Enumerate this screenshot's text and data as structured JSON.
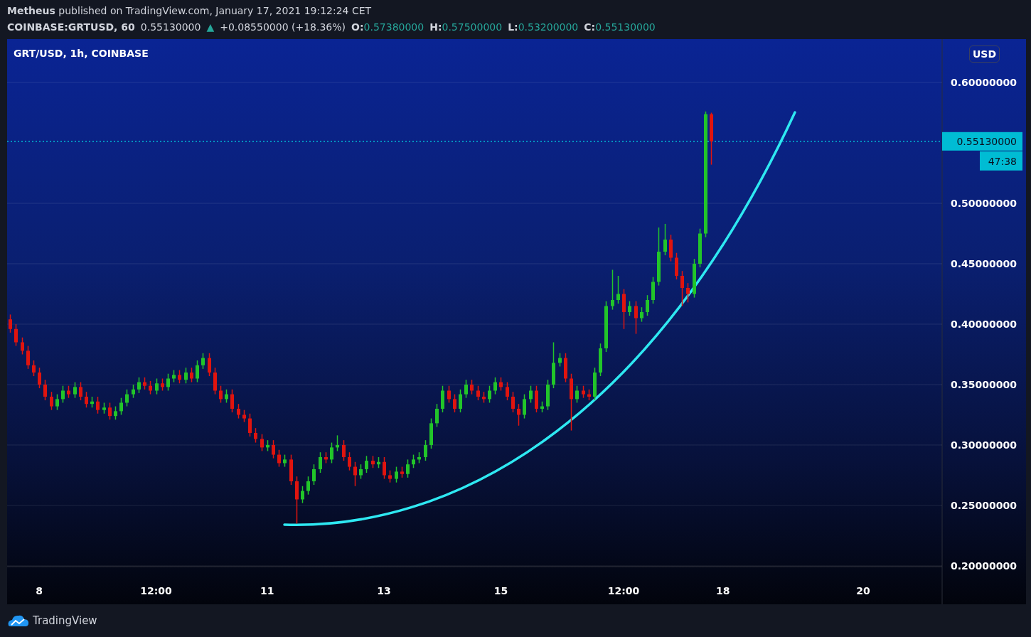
{
  "header": {
    "byline": "**Metheus** published on TradingView.com, January 17, 2021 19:12:24 CET",
    "symbol": "COINBASE:GRTUSD, 60",
    "last": "0.55130000",
    "direction_icon": "▲",
    "change": "+0.08550000 (+18.36%)",
    "ohlc": [
      {
        "label": "O:",
        "value": "0.57380000"
      },
      {
        "label": "H:",
        "value": "0.57500000"
      },
      {
        "label": "L:",
        "value": "0.53200000"
      },
      {
        "label": "C:",
        "value": "0.55130000"
      }
    ]
  },
  "chart_pane": {
    "legend": "GRT/USD, 1h, COINBASE",
    "currency_button": "USD",
    "last_price_label": "0.55130000",
    "countdown": "47:38",
    "chart_data": {
      "type": "candlestick",
      "grid": true,
      "ylim": [
        0.1682,
        0.6359
      ],
      "yticks": [
        {
          "value": 0.2,
          "label": "0.20000000"
        },
        {
          "value": 0.25,
          "label": "0.25000000"
        },
        {
          "value": 0.3,
          "label": "0.30000000"
        },
        {
          "value": 0.35,
          "label": "0.35000000"
        },
        {
          "value": 0.4,
          "label": "0.40000000"
        },
        {
          "value": 0.45,
          "label": "0.45000000"
        },
        {
          "value": 0.5,
          "label": "0.50000000"
        },
        {
          "value": 0.6,
          "label": "0.60000000"
        }
      ],
      "ref_lines": [
        {
          "axis": "y",
          "value": 0.5513,
          "color": "#00bcd4"
        }
      ],
      "categories": [
        null,
        null,
        null,
        null,
        null,
        "8",
        null,
        null,
        null,
        null,
        null,
        null,
        null,
        null,
        null,
        null,
        null,
        null,
        null,
        null,
        null,
        null,
        null,
        null,
        null,
        "12:00",
        null,
        null,
        null,
        null,
        null,
        null,
        null,
        null,
        null,
        null,
        null,
        null,
        null,
        null,
        null,
        null,
        null,
        null,
        "11",
        null,
        null,
        null,
        null,
        null,
        null,
        null,
        null,
        null,
        null,
        null,
        null,
        null,
        null,
        null,
        null,
        null,
        null,
        null,
        "13",
        null,
        null,
        null,
        null,
        null,
        null,
        null,
        null,
        null,
        null,
        null,
        null,
        null,
        null,
        null,
        null,
        null,
        null,
        null,
        "15",
        null,
        null,
        null,
        null,
        null,
        null,
        null,
        null,
        null,
        null,
        null,
        null,
        null,
        null,
        null,
        null,
        null,
        null,
        null,
        null,
        "12:00",
        null,
        null,
        null,
        null,
        null,
        null,
        null,
        null,
        null,
        null,
        null,
        null,
        null,
        null,
        null,
        null,
        "18",
        null,
        null,
        null,
        null,
        null,
        null,
        null,
        null,
        null,
        null,
        null,
        null,
        null,
        null,
        null,
        null,
        null,
        null,
        null,
        null,
        null,
        null,
        null,
        "20",
        null,
        null,
        null,
        null,
        null,
        null,
        null,
        null,
        null,
        null,
        null,
        null,
        null
      ],
      "ohlc": [
        [
          0.404,
          0.408,
          0.393,
          0.396
        ],
        [
          0.396,
          0.4,
          0.382,
          0.385
        ],
        [
          0.385,
          0.389,
          0.375,
          0.378
        ],
        [
          0.378,
          0.382,
          0.363,
          0.366
        ],
        [
          0.366,
          0.37,
          0.357,
          0.36
        ],
        [
          0.36,
          0.364,
          0.347,
          0.35
        ],
        [
          0.35,
          0.354,
          0.337,
          0.34
        ],
        [
          0.34,
          0.344,
          0.329,
          0.332
        ],
        [
          0.332,
          0.342,
          0.329,
          0.338
        ],
        [
          0.338,
          0.349,
          0.335,
          0.345
        ],
        [
          0.345,
          0.349,
          0.339,
          0.342
        ],
        [
          0.342,
          0.352,
          0.339,
          0.348
        ],
        [
          0.348,
          0.352,
          0.337,
          0.34
        ],
        [
          0.34,
          0.344,
          0.331,
          0.334
        ],
        [
          0.334,
          0.34,
          0.331,
          0.336
        ],
        [
          0.336,
          0.34,
          0.326,
          0.329
        ],
        [
          0.329,
          0.335,
          0.326,
          0.331
        ],
        [
          0.331,
          0.335,
          0.321,
          0.324
        ],
        [
          0.324,
          0.332,
          0.321,
          0.328
        ],
        [
          0.328,
          0.339,
          0.325,
          0.335
        ],
        [
          0.335,
          0.346,
          0.332,
          0.342
        ],
        [
          0.342,
          0.35,
          0.339,
          0.346
        ],
        [
          0.346,
          0.356,
          0.343,
          0.352
        ],
        [
          0.352,
          0.356,
          0.346,
          0.349
        ],
        [
          0.349,
          0.353,
          0.342,
          0.345
        ],
        [
          0.345,
          0.355,
          0.342,
          0.351
        ],
        [
          0.351,
          0.355,
          0.345,
          0.348
        ],
        [
          0.348,
          0.359,
          0.345,
          0.355
        ],
        [
          0.355,
          0.362,
          0.352,
          0.358
        ],
        [
          0.358,
          0.362,
          0.351,
          0.354
        ],
        [
          0.354,
          0.364,
          0.351,
          0.36
        ],
        [
          0.36,
          0.364,
          0.352,
          0.355
        ],
        [
          0.355,
          0.37,
          0.352,
          0.366
        ],
        [
          0.366,
          0.376,
          0.363,
          0.372
        ],
        [
          0.372,
          0.376,
          0.357,
          0.36
        ],
        [
          0.36,
          0.364,
          0.342,
          0.345
        ],
        [
          0.345,
          0.349,
          0.335,
          0.338
        ],
        [
          0.338,
          0.346,
          0.335,
          0.342
        ],
        [
          0.342,
          0.346,
          0.327,
          0.33
        ],
        [
          0.33,
          0.334,
          0.322,
          0.325
        ],
        [
          0.325,
          0.329,
          0.319,
          0.322
        ],
        [
          0.322,
          0.326,
          0.307,
          0.31
        ],
        [
          0.31,
          0.314,
          0.302,
          0.305
        ],
        [
          0.305,
          0.309,
          0.295,
          0.298
        ],
        [
          0.298,
          0.304,
          0.295,
          0.3
        ],
        [
          0.3,
          0.304,
          0.289,
          0.292
        ],
        [
          0.292,
          0.296,
          0.282,
          0.285
        ],
        [
          0.285,
          0.292,
          0.282,
          0.288
        ],
        [
          0.288,
          0.292,
          0.267,
          0.27
        ],
        [
          0.27,
          0.274,
          0.235,
          0.255
        ],
        [
          0.255,
          0.266,
          0.252,
          0.262
        ],
        [
          0.262,
          0.274,
          0.259,
          0.27
        ],
        [
          0.27,
          0.284,
          0.267,
          0.28
        ],
        [
          0.28,
          0.294,
          0.277,
          0.29
        ],
        [
          0.29,
          0.294,
          0.285,
          0.288
        ],
        [
          0.288,
          0.302,
          0.285,
          0.298
        ],
        [
          0.298,
          0.308,
          0.295,
          0.3
        ],
        [
          0.3,
          0.304,
          0.287,
          0.29
        ],
        [
          0.29,
          0.294,
          0.279,
          0.282
        ],
        [
          0.282,
          0.286,
          0.266,
          0.275
        ],
        [
          0.275,
          0.284,
          0.272,
          0.28
        ],
        [
          0.28,
          0.291,
          0.277,
          0.287
        ],
        [
          0.287,
          0.291,
          0.281,
          0.284
        ],
        [
          0.284,
          0.29,
          0.281,
          0.286
        ],
        [
          0.286,
          0.29,
          0.272,
          0.275
        ],
        [
          0.275,
          0.279,
          0.269,
          0.272
        ],
        [
          0.272,
          0.282,
          0.269,
          0.278
        ],
        [
          0.278,
          0.282,
          0.273,
          0.276
        ],
        [
          0.276,
          0.288,
          0.273,
          0.284
        ],
        [
          0.284,
          0.292,
          0.281,
          0.288
        ],
        [
          0.288,
          0.294,
          0.285,
          0.29
        ],
        [
          0.29,
          0.304,
          0.287,
          0.3
        ],
        [
          0.3,
          0.322,
          0.297,
          0.318
        ],
        [
          0.318,
          0.334,
          0.315,
          0.33
        ],
        [
          0.33,
          0.349,
          0.327,
          0.345
        ],
        [
          0.345,
          0.349,
          0.335,
          0.338
        ],
        [
          0.338,
          0.342,
          0.327,
          0.33
        ],
        [
          0.33,
          0.346,
          0.327,
          0.342
        ],
        [
          0.342,
          0.354,
          0.339,
          0.35
        ],
        [
          0.35,
          0.354,
          0.342,
          0.345
        ],
        [
          0.345,
          0.349,
          0.337,
          0.34
        ],
        [
          0.34,
          0.344,
          0.335,
          0.338
        ],
        [
          0.338,
          0.349,
          0.335,
          0.345
        ],
        [
          0.345,
          0.356,
          0.342,
          0.352
        ],
        [
          0.352,
          0.356,
          0.345,
          0.348
        ],
        [
          0.348,
          0.352,
          0.337,
          0.34
        ],
        [
          0.34,
          0.344,
          0.327,
          0.33
        ],
        [
          0.33,
          0.334,
          0.316,
          0.325
        ],
        [
          0.325,
          0.342,
          0.322,
          0.338
        ],
        [
          0.338,
          0.349,
          0.335,
          0.345
        ],
        [
          0.345,
          0.349,
          0.327,
          0.33
        ],
        [
          0.33,
          0.336,
          0.327,
          0.332
        ],
        [
          0.332,
          0.354,
          0.329,
          0.35
        ],
        [
          0.35,
          0.385,
          0.347,
          0.368
        ],
        [
          0.368,
          0.376,
          0.365,
          0.372
        ],
        [
          0.372,
          0.376,
          0.352,
          0.355
        ],
        [
          0.355,
          0.359,
          0.312,
          0.338
        ],
        [
          0.338,
          0.349,
          0.335,
          0.345
        ],
        [
          0.345,
          0.349,
          0.339,
          0.342
        ],
        [
          0.342,
          0.346,
          0.337,
          0.34
        ],
        [
          0.34,
          0.364,
          0.337,
          0.36
        ],
        [
          0.36,
          0.384,
          0.357,
          0.38
        ],
        [
          0.38,
          0.419,
          0.377,
          0.415
        ],
        [
          0.415,
          0.445,
          0.412,
          0.42
        ],
        [
          0.42,
          0.44,
          0.417,
          0.425
        ],
        [
          0.425,
          0.429,
          0.396,
          0.41
        ],
        [
          0.41,
          0.419,
          0.407,
          0.415
        ],
        [
          0.415,
          0.419,
          0.392,
          0.405
        ],
        [
          0.405,
          0.414,
          0.402,
          0.41
        ],
        [
          0.41,
          0.424,
          0.407,
          0.42
        ],
        [
          0.42,
          0.439,
          0.417,
          0.435
        ],
        [
          0.435,
          0.48,
          0.432,
          0.46
        ],
        [
          0.46,
          0.483,
          0.457,
          0.47
        ],
        [
          0.47,
          0.474,
          0.452,
          0.455
        ],
        [
          0.455,
          0.459,
          0.437,
          0.44
        ],
        [
          0.44,
          0.444,
          0.415,
          0.43
        ],
        [
          0.43,
          0.434,
          0.418,
          0.425
        ],
        [
          0.425,
          0.454,
          0.422,
          0.45
        ],
        [
          0.45,
          0.479,
          0.447,
          0.475
        ],
        [
          0.475,
          0.576,
          0.472,
          0.5738
        ],
        [
          0.5738,
          0.575,
          0.532,
          0.5513
        ],
        null,
        null,
        null,
        null,
        null,
        null,
        null,
        null,
        null,
        null,
        null,
        null,
        null,
        null,
        null,
        null,
        null,
        null,
        null,
        null,
        null,
        null,
        null,
        null,
        null,
        null,
        null,
        null,
        null,
        null,
        null,
        null,
        null,
        null,
        null,
        null,
        null,
        null,
        null
      ]
    }
  },
  "footer": {
    "brand": "TradingView"
  }
}
